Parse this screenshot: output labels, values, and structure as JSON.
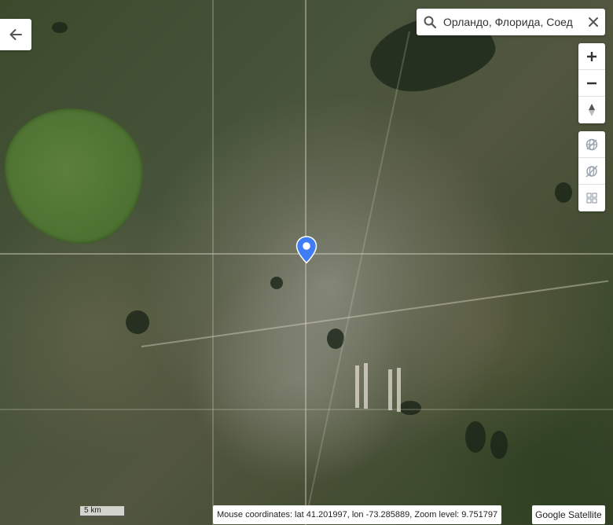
{
  "search": {
    "value": "Орландо, Флорида, Соед",
    "placeholder": ""
  },
  "controls": {
    "zoom_in": "+",
    "zoom_out": "−"
  },
  "scale": {
    "label": "5 km"
  },
  "status": {
    "coordinates": "Mouse coordinates: lat 41.201997, lon -73.285889, Zoom level: 9.751797"
  },
  "provider": {
    "label": "Google Satellite"
  },
  "colors": {
    "marker": "#3f7cf5",
    "control_icon": "#444444",
    "disabled_icon": "#9aa4b0"
  },
  "icons": {
    "back": "arrow-left-icon",
    "search": "search-icon",
    "clear": "close-icon",
    "north": "compass-icon",
    "layers_a": "globe-layers-icon",
    "layers_b": "globe-off-icon",
    "grid": "grid-icon",
    "marker": "location-pin-icon"
  }
}
